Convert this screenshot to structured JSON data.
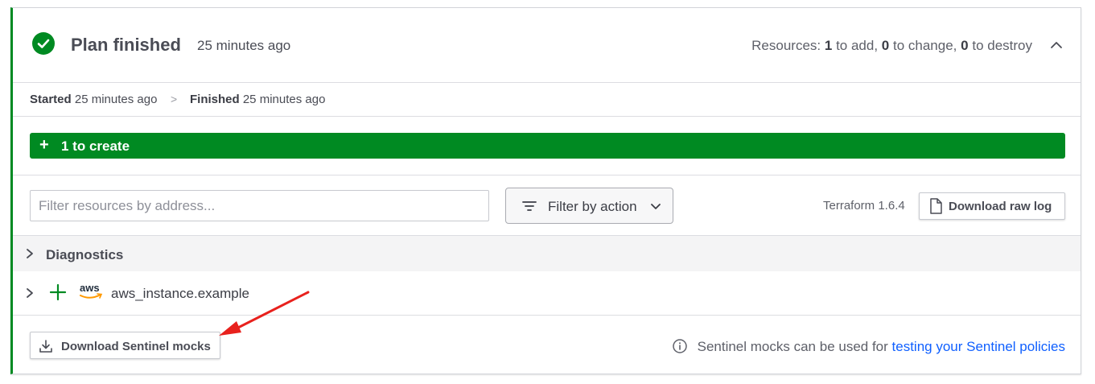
{
  "header": {
    "title": "Plan finished",
    "time": "25 minutes ago",
    "resources_prefix": "Resources:",
    "add_count": "1",
    "add_text": "to add,",
    "change_count": "0",
    "change_text": "to change,",
    "destroy_count": "0",
    "destroy_text": "to destroy"
  },
  "timeline": {
    "started_label": "Started",
    "started_time": "25 minutes ago",
    "separator": ">",
    "finished_label": "Finished",
    "finished_time": "25 minutes ago"
  },
  "summary": {
    "create_label": "1 to create",
    "color": "#008a22"
  },
  "filters": {
    "search_placeholder": "Filter resources by address...",
    "action_label": "Filter by action",
    "terraform_version": "Terraform 1.6.4",
    "raw_log_label": "Download raw log"
  },
  "rows": {
    "diagnostics_label": "Diagnostics",
    "resource_label": "aws_instance.example",
    "provider_icon": "aws-logo"
  },
  "footer": {
    "mocks_button": "Download Sentinel mocks",
    "info_text": "Sentinel mocks can be used for",
    "info_link": "testing your Sentinel policies"
  },
  "colors": {
    "success": "#008a22",
    "link": "#1060ff",
    "annotation_arrow": "#e8211d"
  }
}
